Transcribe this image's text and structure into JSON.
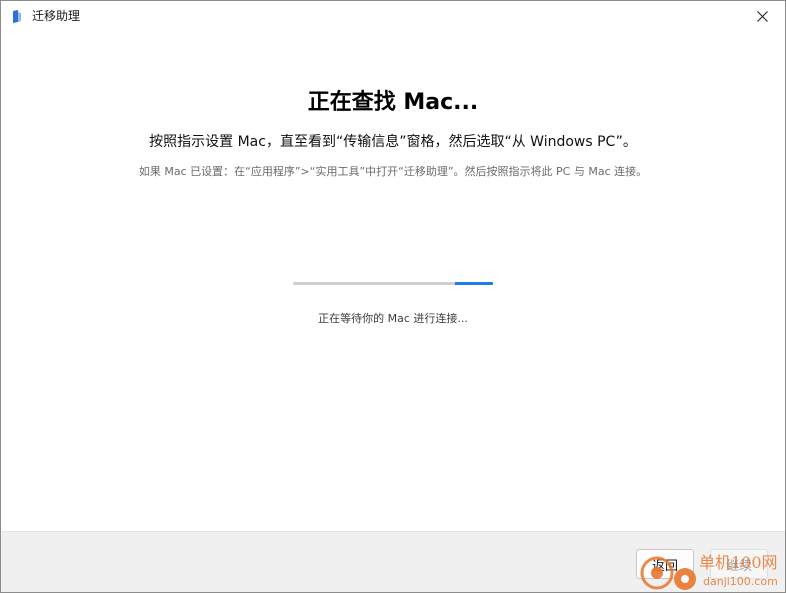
{
  "window": {
    "title": "迁移助理",
    "close_icon": "close-icon",
    "app_icon": "migration-assistant-icon"
  },
  "main": {
    "heading": "正在查找 Mac...",
    "instruction": "按照指示设置 Mac，直至看到“传输信息”窗格，然后选取“从 Windows PC”。",
    "hint": "如果 Mac 已设置：在“应用程序”>“实用工具”中打开“迁移助理”。然后按照指示将此 PC 与 Mac 连接。",
    "progress": {
      "state": "indeterminate",
      "indicator_color": "#1e7ce8",
      "track_color": "#cfcfcf"
    },
    "status": "正在等待你的 Mac 进行连接..."
  },
  "footer": {
    "back_label": "返回",
    "next_label": "继续"
  },
  "watermark": {
    "site_name": "单机100网",
    "url": "danji100.com"
  },
  "colors": {
    "accent": "#1e7ce8",
    "footer_bg": "#f0f0f0",
    "watermark": "#e8762d"
  }
}
